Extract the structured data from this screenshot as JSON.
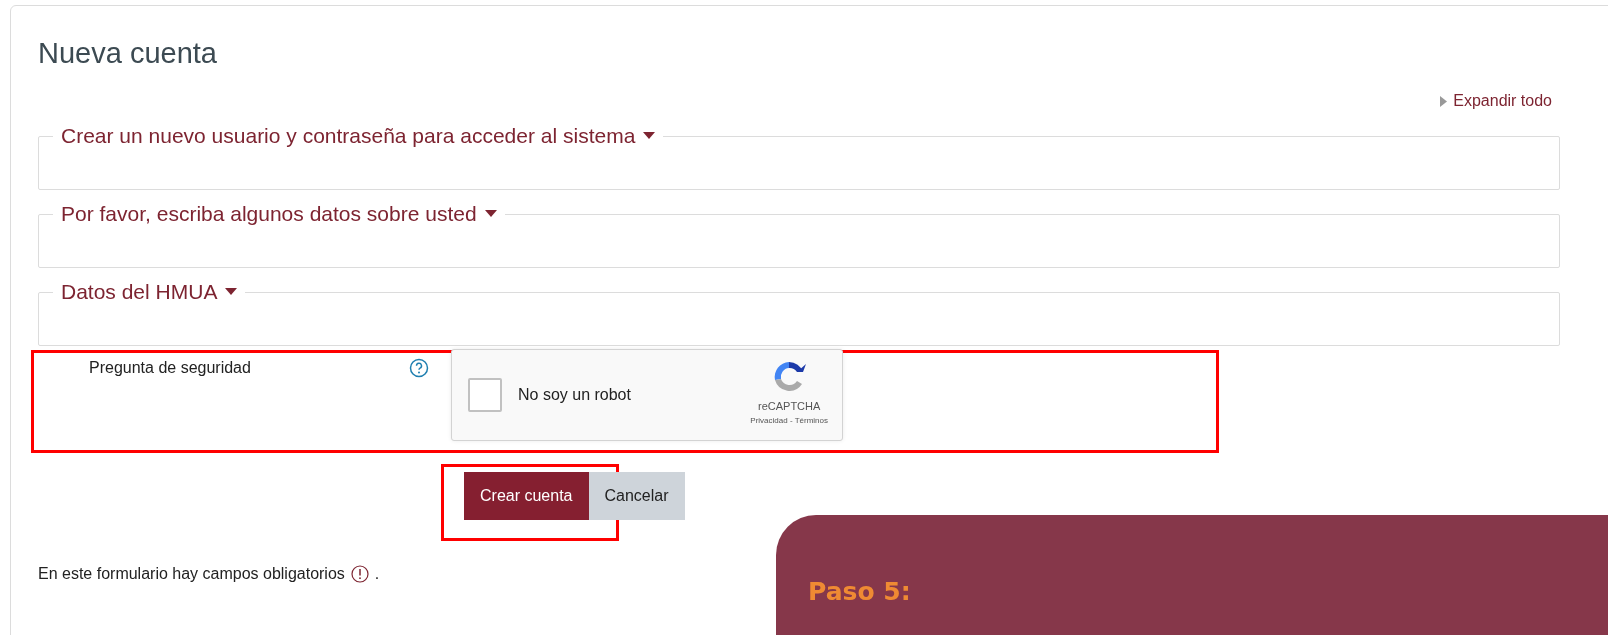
{
  "title": "Nueva cuenta",
  "expand_all": "Expandir todo",
  "sections": [
    {
      "label": "Crear un nuevo usuario y contraseña para acceder al sistema"
    },
    {
      "label": "Por favor, escriba algunos datos sobre usted"
    },
    {
      "label": "Datos del HMUA"
    }
  ],
  "security": {
    "label": "Pregunta de seguridad",
    "captcha": {
      "checkbox_label": "No soy un robot",
      "checked": false,
      "brand": "reCAPTCHA",
      "links": "Privacidad - Términos"
    }
  },
  "buttons": [
    {
      "label": "Crear cuenta",
      "kind": "primary"
    },
    {
      "label": "Cancelar",
      "kind": "secondary"
    }
  ],
  "required_note": {
    "text": "En este formulario hay campos obligatorios",
    "suffix": "."
  },
  "callout": {
    "title": "Paso 5:"
  }
}
